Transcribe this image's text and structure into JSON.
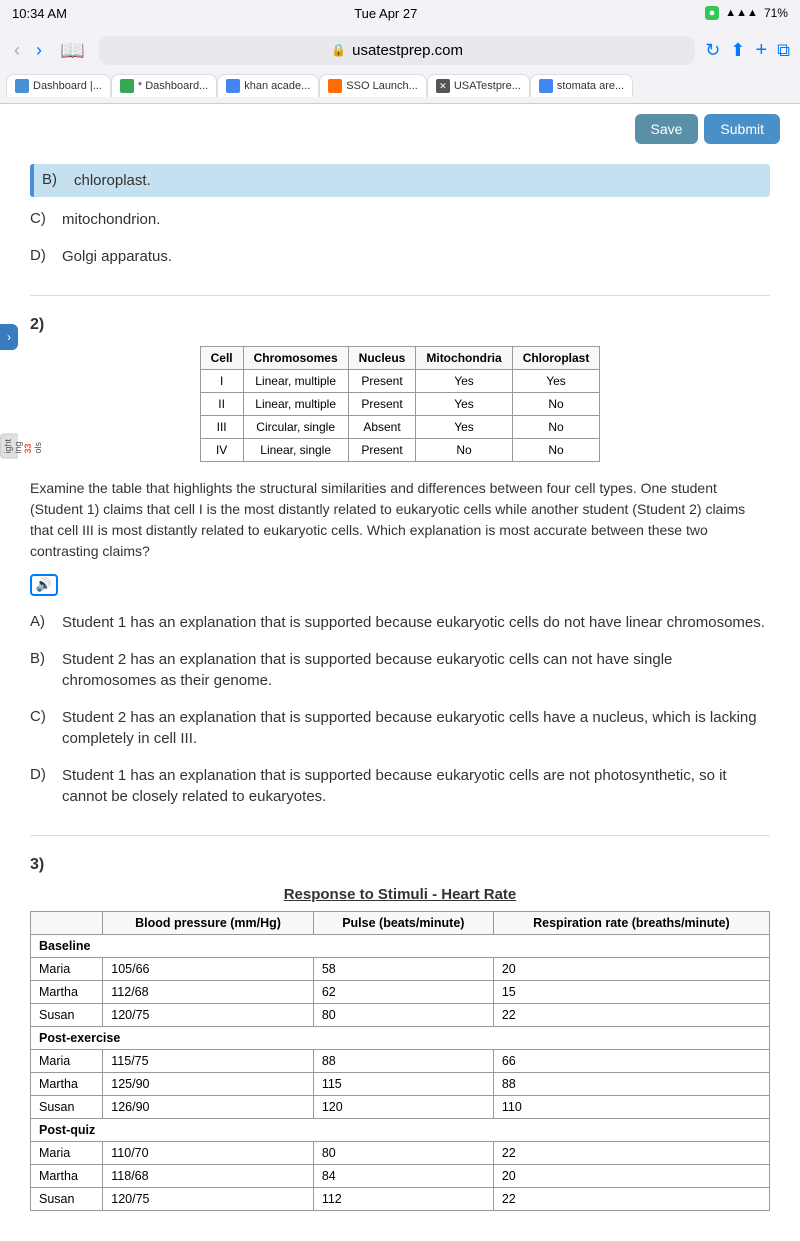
{
  "statusBar": {
    "time": "10:34 AM",
    "day": "Tue Apr 27",
    "wifi": "▲▲▲",
    "battery": "71%"
  },
  "browser": {
    "url": "usatestprep.com",
    "tabs": [
      {
        "label": "Dashboard |...",
        "type": "blue",
        "active": false
      },
      {
        "label": "* Dashboard...",
        "type": "green",
        "active": false
      },
      {
        "label": "khan acade...",
        "type": "g",
        "active": false
      },
      {
        "label": "SSO Launch...",
        "type": "orange",
        "active": false
      },
      {
        "label": "USATestpre...",
        "type": "x",
        "active": true
      },
      {
        "label": "stomata are...",
        "type": "g2",
        "active": false
      }
    ]
  },
  "buttons": {
    "save": "Save",
    "submit": "Submit"
  },
  "question1": {
    "options": [
      {
        "letter": "B)",
        "text": "chloroplast.",
        "selected": true
      },
      {
        "letter": "C)",
        "text": "mitochondrion."
      },
      {
        "letter": "D)",
        "text": "Golgi apparatus."
      }
    ]
  },
  "question2": {
    "num": "2)",
    "tableHeaders": [
      "Cell",
      "Chromosomes",
      "Nucleus",
      "Mitochondria",
      "Chloroplast"
    ],
    "tableRows": [
      [
        "I",
        "Linear, multiple",
        "Present",
        "Yes",
        "Yes"
      ],
      [
        "II",
        "Linear, multiple",
        "Present",
        "Yes",
        "No"
      ],
      [
        "III",
        "Circular, single",
        "Absent",
        "Yes",
        "No"
      ],
      [
        "IV",
        "Linear, single",
        "Present",
        "No",
        "No"
      ]
    ],
    "body": "Examine the table that highlights the structural similarities and differences between four cell types. One student (Student 1) claims that cell I is the most distantly related to eukaryotic cells while another student (Student 2) claims that cell III is most distantly related to eukaryotic cells. Which explanation is most accurate between these two contrasting claims?",
    "options": [
      {
        "letter": "A)",
        "text": "Student 1 has an explanation that is supported because eukaryotic cells do not have linear chromosomes."
      },
      {
        "letter": "B)",
        "text": "Student 2 has an explanation that is supported because eukaryotic cells can not have single chromosomes as their genome."
      },
      {
        "letter": "C)",
        "text": "Student 2 has an explanation that is supported because eukaryotic cells have a nucleus, which is lacking completely in cell III."
      },
      {
        "letter": "D)",
        "text": "Student 1 has an explanation that is supported because eukaryotic cells are not photosynthetic, so it cannot be closely related to eukaryotes."
      }
    ]
  },
  "question3": {
    "num": "3)",
    "tableTitle": "Response to Stimuli - Heart Rate",
    "tableHeaders": [
      "",
      "Blood pressure (mm/Hg)",
      "Pulse (beats/minute)",
      "Respiration rate (breaths/minute)"
    ],
    "sections": [
      {
        "label": "Baseline",
        "rows": [
          {
            "subject": "Maria",
            "bp": "105/66",
            "pulse": "58",
            "resp": "20"
          },
          {
            "subject": "Martha",
            "bp": "112/68",
            "pulse": "62",
            "resp": "15"
          },
          {
            "subject": "Susan",
            "bp": "120/75",
            "pulse": "80",
            "resp": "22"
          }
        ]
      },
      {
        "label": "Post-exercise",
        "rows": [
          {
            "subject": "Maria",
            "bp": "115/75",
            "pulse": "88",
            "resp": "66"
          },
          {
            "subject": "Martha",
            "bp": "125/90",
            "pulse": "115",
            "resp": "88"
          },
          {
            "subject": "Susan",
            "bp": "126/90",
            "pulse": "120",
            "resp": "110"
          }
        ]
      },
      {
        "label": "Post-quiz",
        "rows": [
          {
            "subject": "Maria",
            "bp": "110/70",
            "pulse": "80",
            "resp": "22"
          },
          {
            "subject": "Martha",
            "bp": "118/68",
            "pulse": "84",
            "resp": "20"
          },
          {
            "subject": "Susan",
            "bp": "120/75",
            "pulse": "112",
            "resp": "22"
          }
        ]
      }
    ]
  },
  "drawerItems": [
    "ight",
    "ing",
    "33",
    "ols"
  ]
}
